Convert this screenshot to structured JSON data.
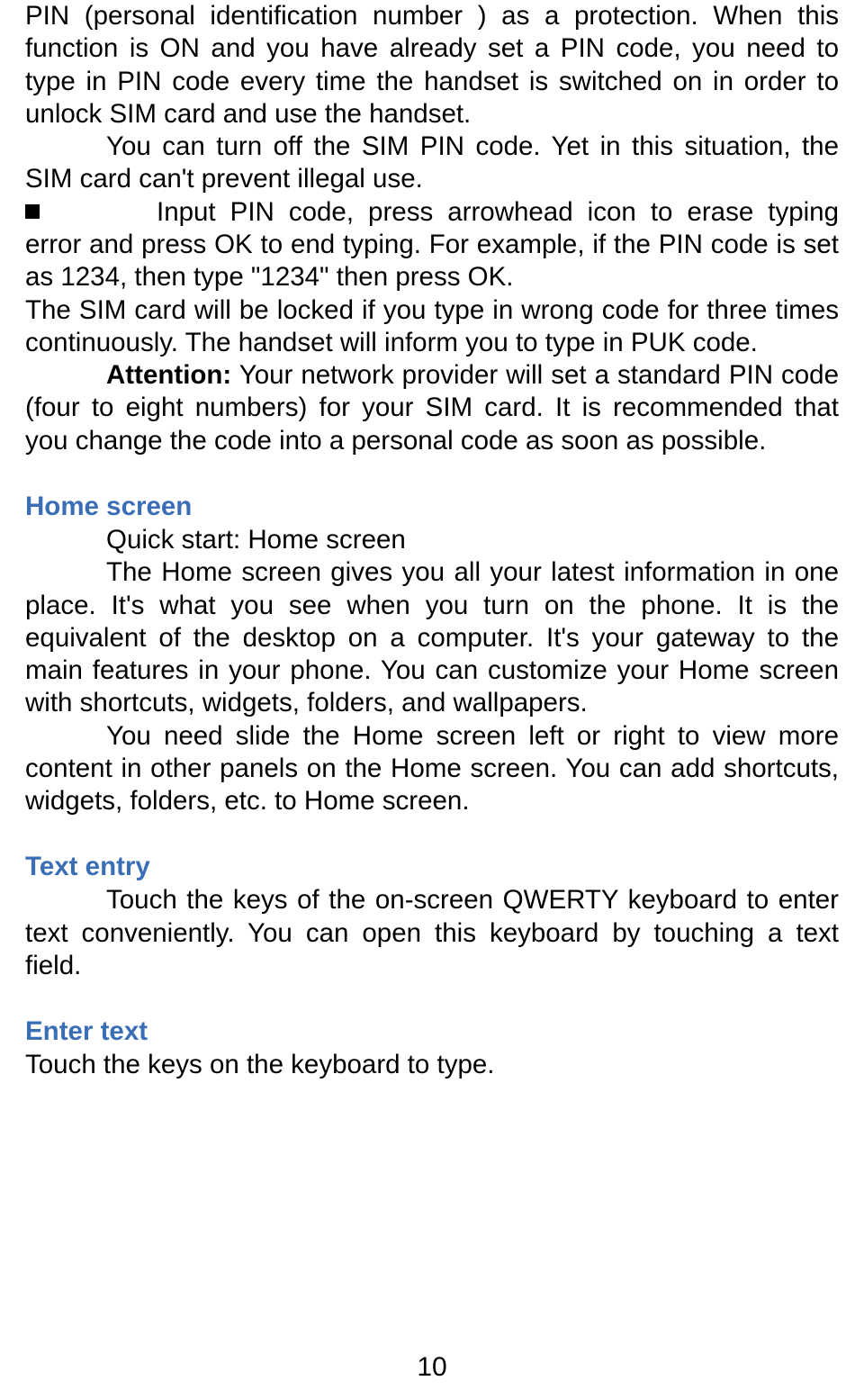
{
  "p1": "PIN (personal identification number ) as a protection. When this function is ON and you have already set a PIN code, you need to type in PIN code every time the handset is switched on in order to unlock SIM card and use the handset.",
  "p2": "You can turn off the SIM PIN code. Yet in this situation, the SIM card can't prevent illegal use.",
  "bullet_text": "Input PIN code, press arrowhead icon to erase typing error and press OK to end typing. For example, if the PIN code is set as 1234, then type \"1234\" then press OK.",
  "p3": "The SIM card will be locked if you type in wrong code for three times continuously. The handset will inform you to type in PUK code.",
  "attention_label": "Attention:",
  "attention_text": " Your network provider will set a standard PIN code (four to eight numbers) for your SIM card. It is recommended that you change the code into a personal code as soon as possible.",
  "home_heading": "Home screen",
  "home_p1": "Quick start: Home screen",
  "home_p2": "The Home screen gives you all your latest information in one place. It's what you see when you turn on the phone. It is the equivalent of the desktop on a computer. It's your gateway to the main features in your phone. You can customize your Home screen with shortcuts, widgets, folders, and wallpapers.",
  "home_p3": "You need slide the Home screen left or right to view more content in other panels on the Home screen. You can add shortcuts, widgets, folders, etc. to Home screen.",
  "text_entry_heading": "Text entry",
  "text_entry_p": "Touch the keys of the on-screen QWERTY keyboard to enter text conveniently. You can open this keyboard by touching a text field.",
  "enter_text_heading": "Enter text",
  "enter_text_p": "Touch the keys on the keyboard to type.",
  "page_number": "10"
}
